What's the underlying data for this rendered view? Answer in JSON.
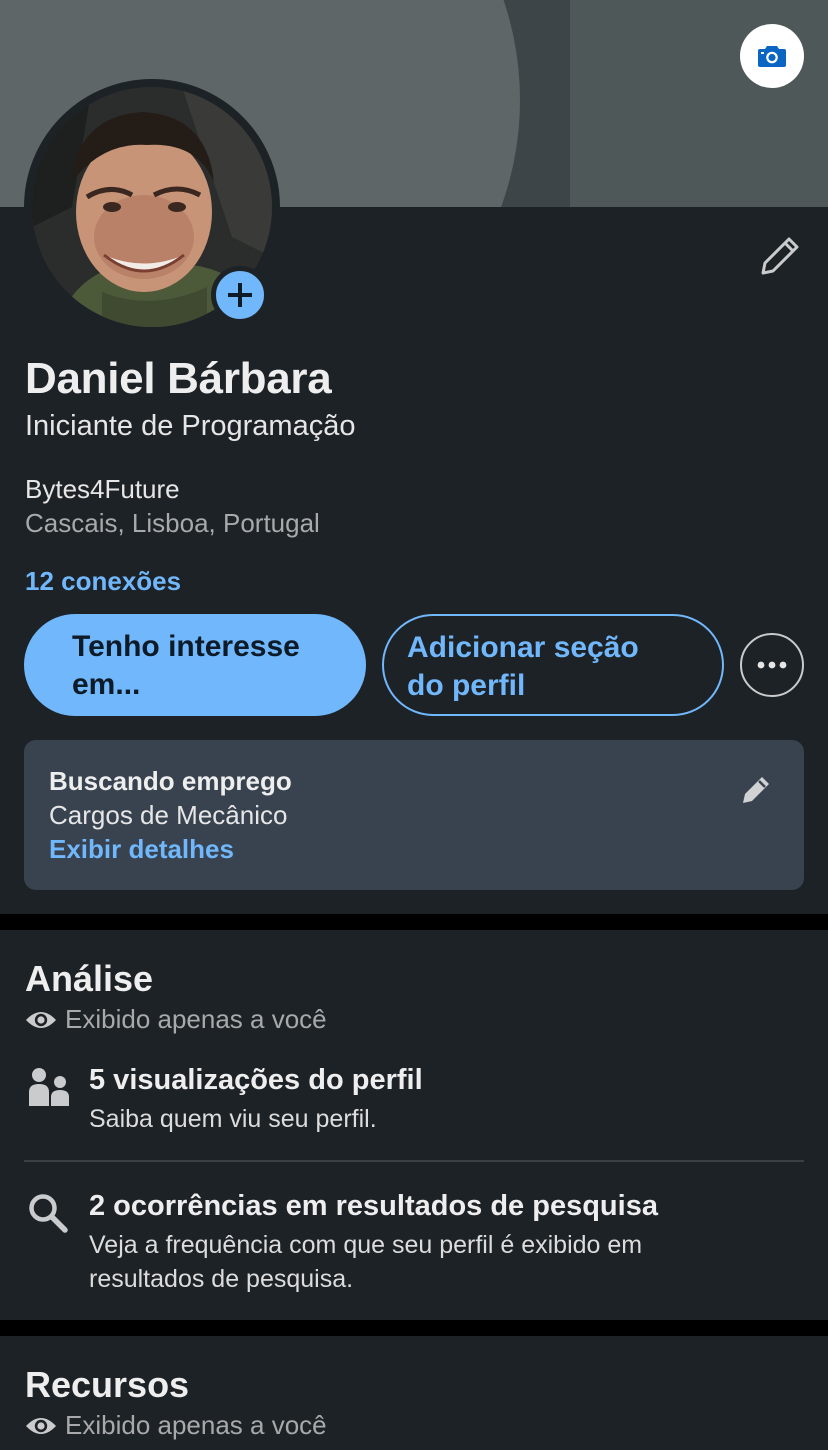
{
  "profile": {
    "name": "Daniel Bárbara",
    "headline": "Iniciante de Programação",
    "company": "Bytes4Future",
    "location": "Cascais, Lisboa, Portugal",
    "connections": "12 conexões"
  },
  "actions": {
    "primary_line1": "Tenho interesse",
    "primary_line2": "em...",
    "secondary_line1": "Adicionar seção",
    "secondary_line2": "do perfil"
  },
  "open_to_work": {
    "title": "Buscando emprego",
    "subtitle": "Cargos de Mecânico",
    "link": "Exibir detalhes"
  },
  "analytics": {
    "title": "Análise",
    "visibility": "Exibido apenas a você",
    "items": [
      {
        "icon": "people-icon",
        "title": "5 visualizações do perfil",
        "description": "Saiba quem viu seu perfil."
      },
      {
        "icon": "search-icon",
        "title": "2 ocorrências em resultados de pesquisa",
        "description": "Veja a frequência com que seu perfil é exibido em resultados de pesquisa."
      }
    ]
  },
  "resources": {
    "title": "Recursos",
    "visibility": "Exibido apenas a você"
  },
  "colors": {
    "accent": "#71b7fb",
    "card_background": "#1d2226",
    "open_to_work_background": "#38434f",
    "camera_icon": "#0a66c2"
  },
  "icons": [
    "camera-icon",
    "plus-icon",
    "pencil-icon",
    "more-icon",
    "eye-icon",
    "people-icon",
    "search-icon"
  ]
}
